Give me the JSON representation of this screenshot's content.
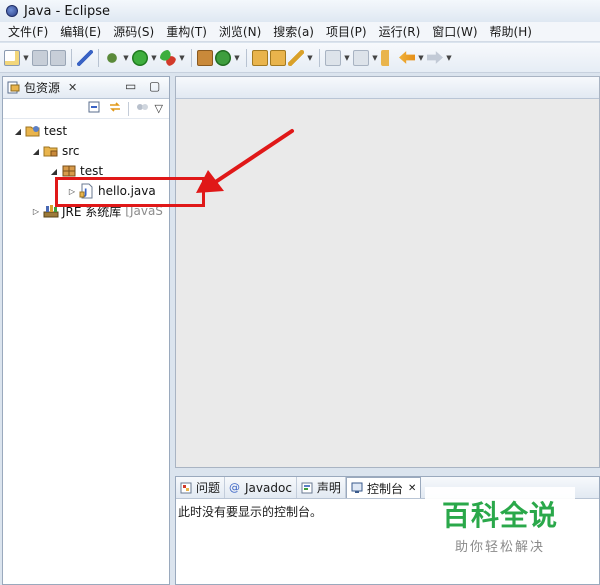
{
  "window": {
    "title": "Java - Eclipse"
  },
  "menu": [
    "文件(F)",
    "编辑(E)",
    "源码(S)",
    "重构(T)",
    "浏览(N)",
    "搜索(a)",
    "项目(P)",
    "运行(R)",
    "窗口(W)",
    "帮助(H)"
  ],
  "package_explorer": {
    "tab_label": "包资源",
    "close_glyph": "✕",
    "minimize_glyph": "▭",
    "maximize_glyph": "▢",
    "view_menu_glyph": "▽"
  },
  "tree": {
    "project": "test",
    "src": "src",
    "package": "test",
    "file": "hello.java",
    "jre": "JRE 系统库",
    "jre_suffix": "[JavaS"
  },
  "bottom_tabs": [
    {
      "label": "问题",
      "icon": "problems-icon"
    },
    {
      "label": "Javadoc",
      "icon": "at-icon"
    },
    {
      "label": "声明",
      "icon": "declaration-icon"
    },
    {
      "label": "控制台",
      "icon": "console-icon",
      "close": "✕"
    }
  ],
  "console": {
    "message": "此时没有要显示的控制台。"
  },
  "watermark": {
    "main": "百科全说",
    "sub": "助你轻松解决"
  },
  "colors": {
    "annotation": "#e01818",
    "watermark_green": "#2aa84a",
    "folder": "#e9b44c"
  }
}
